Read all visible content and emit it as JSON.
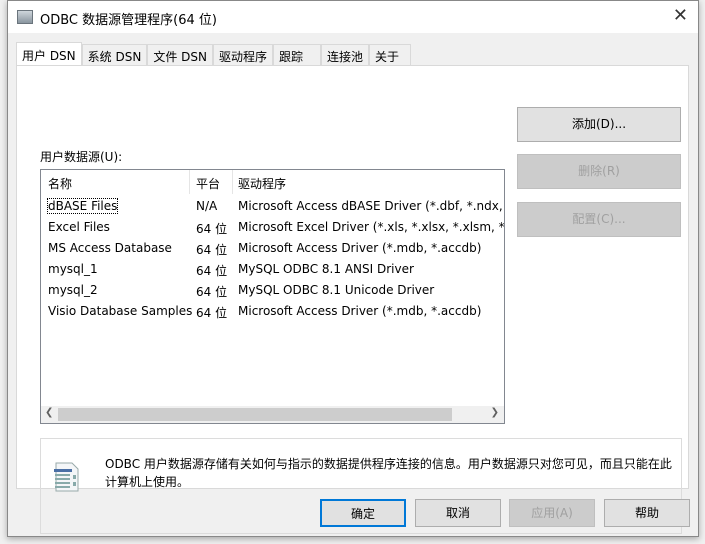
{
  "window": {
    "title": "ODBC 数据源管理程序(64 位)",
    "close": "✕"
  },
  "tabs": [
    "用户 DSN",
    "系统 DSN",
    "文件 DSN",
    "驱动程序",
    "跟踪",
    "连接池",
    "关于"
  ],
  "list_label": "用户数据源(U):",
  "columns": [
    "名称",
    "平台",
    "驱动程序"
  ],
  "rows": [
    {
      "name": "dBASE Files",
      "platform": "N/A",
      "driver": "Microsoft Access dBASE Driver (*.dbf, *.ndx, *.mdx)"
    },
    {
      "name": "Excel Files",
      "platform": "64 位",
      "driver": "Microsoft Excel Driver (*.xls, *.xlsx, *.xlsm, *.xlsb)"
    },
    {
      "name": "MS Access Database",
      "platform": "64 位",
      "driver": "Microsoft Access Driver (*.mdb, *.accdb)"
    },
    {
      "name": "mysql_1",
      "platform": "64 位",
      "driver": "MySQL ODBC 8.1 ANSI Driver"
    },
    {
      "name": "mysql_2",
      "platform": "64 位",
      "driver": "MySQL ODBC 8.1 Unicode Driver"
    },
    {
      "name": "Visio Database Samples",
      "platform": "64 位",
      "driver": "Microsoft Access Driver (*.mdb, *.accdb)"
    }
  ],
  "side_buttons": {
    "add": "添加(D)...",
    "remove": "删除(R)",
    "configure": "配置(C)..."
  },
  "info": "ODBC 用户数据源存储有关如何与指示的数据提供程序连接的信息。用户数据源只对您可见，而且只能在此计算机上使用。",
  "bottom_buttons": {
    "ok": "确定",
    "cancel": "取消",
    "apply": "应用(A)",
    "help": "帮助"
  }
}
